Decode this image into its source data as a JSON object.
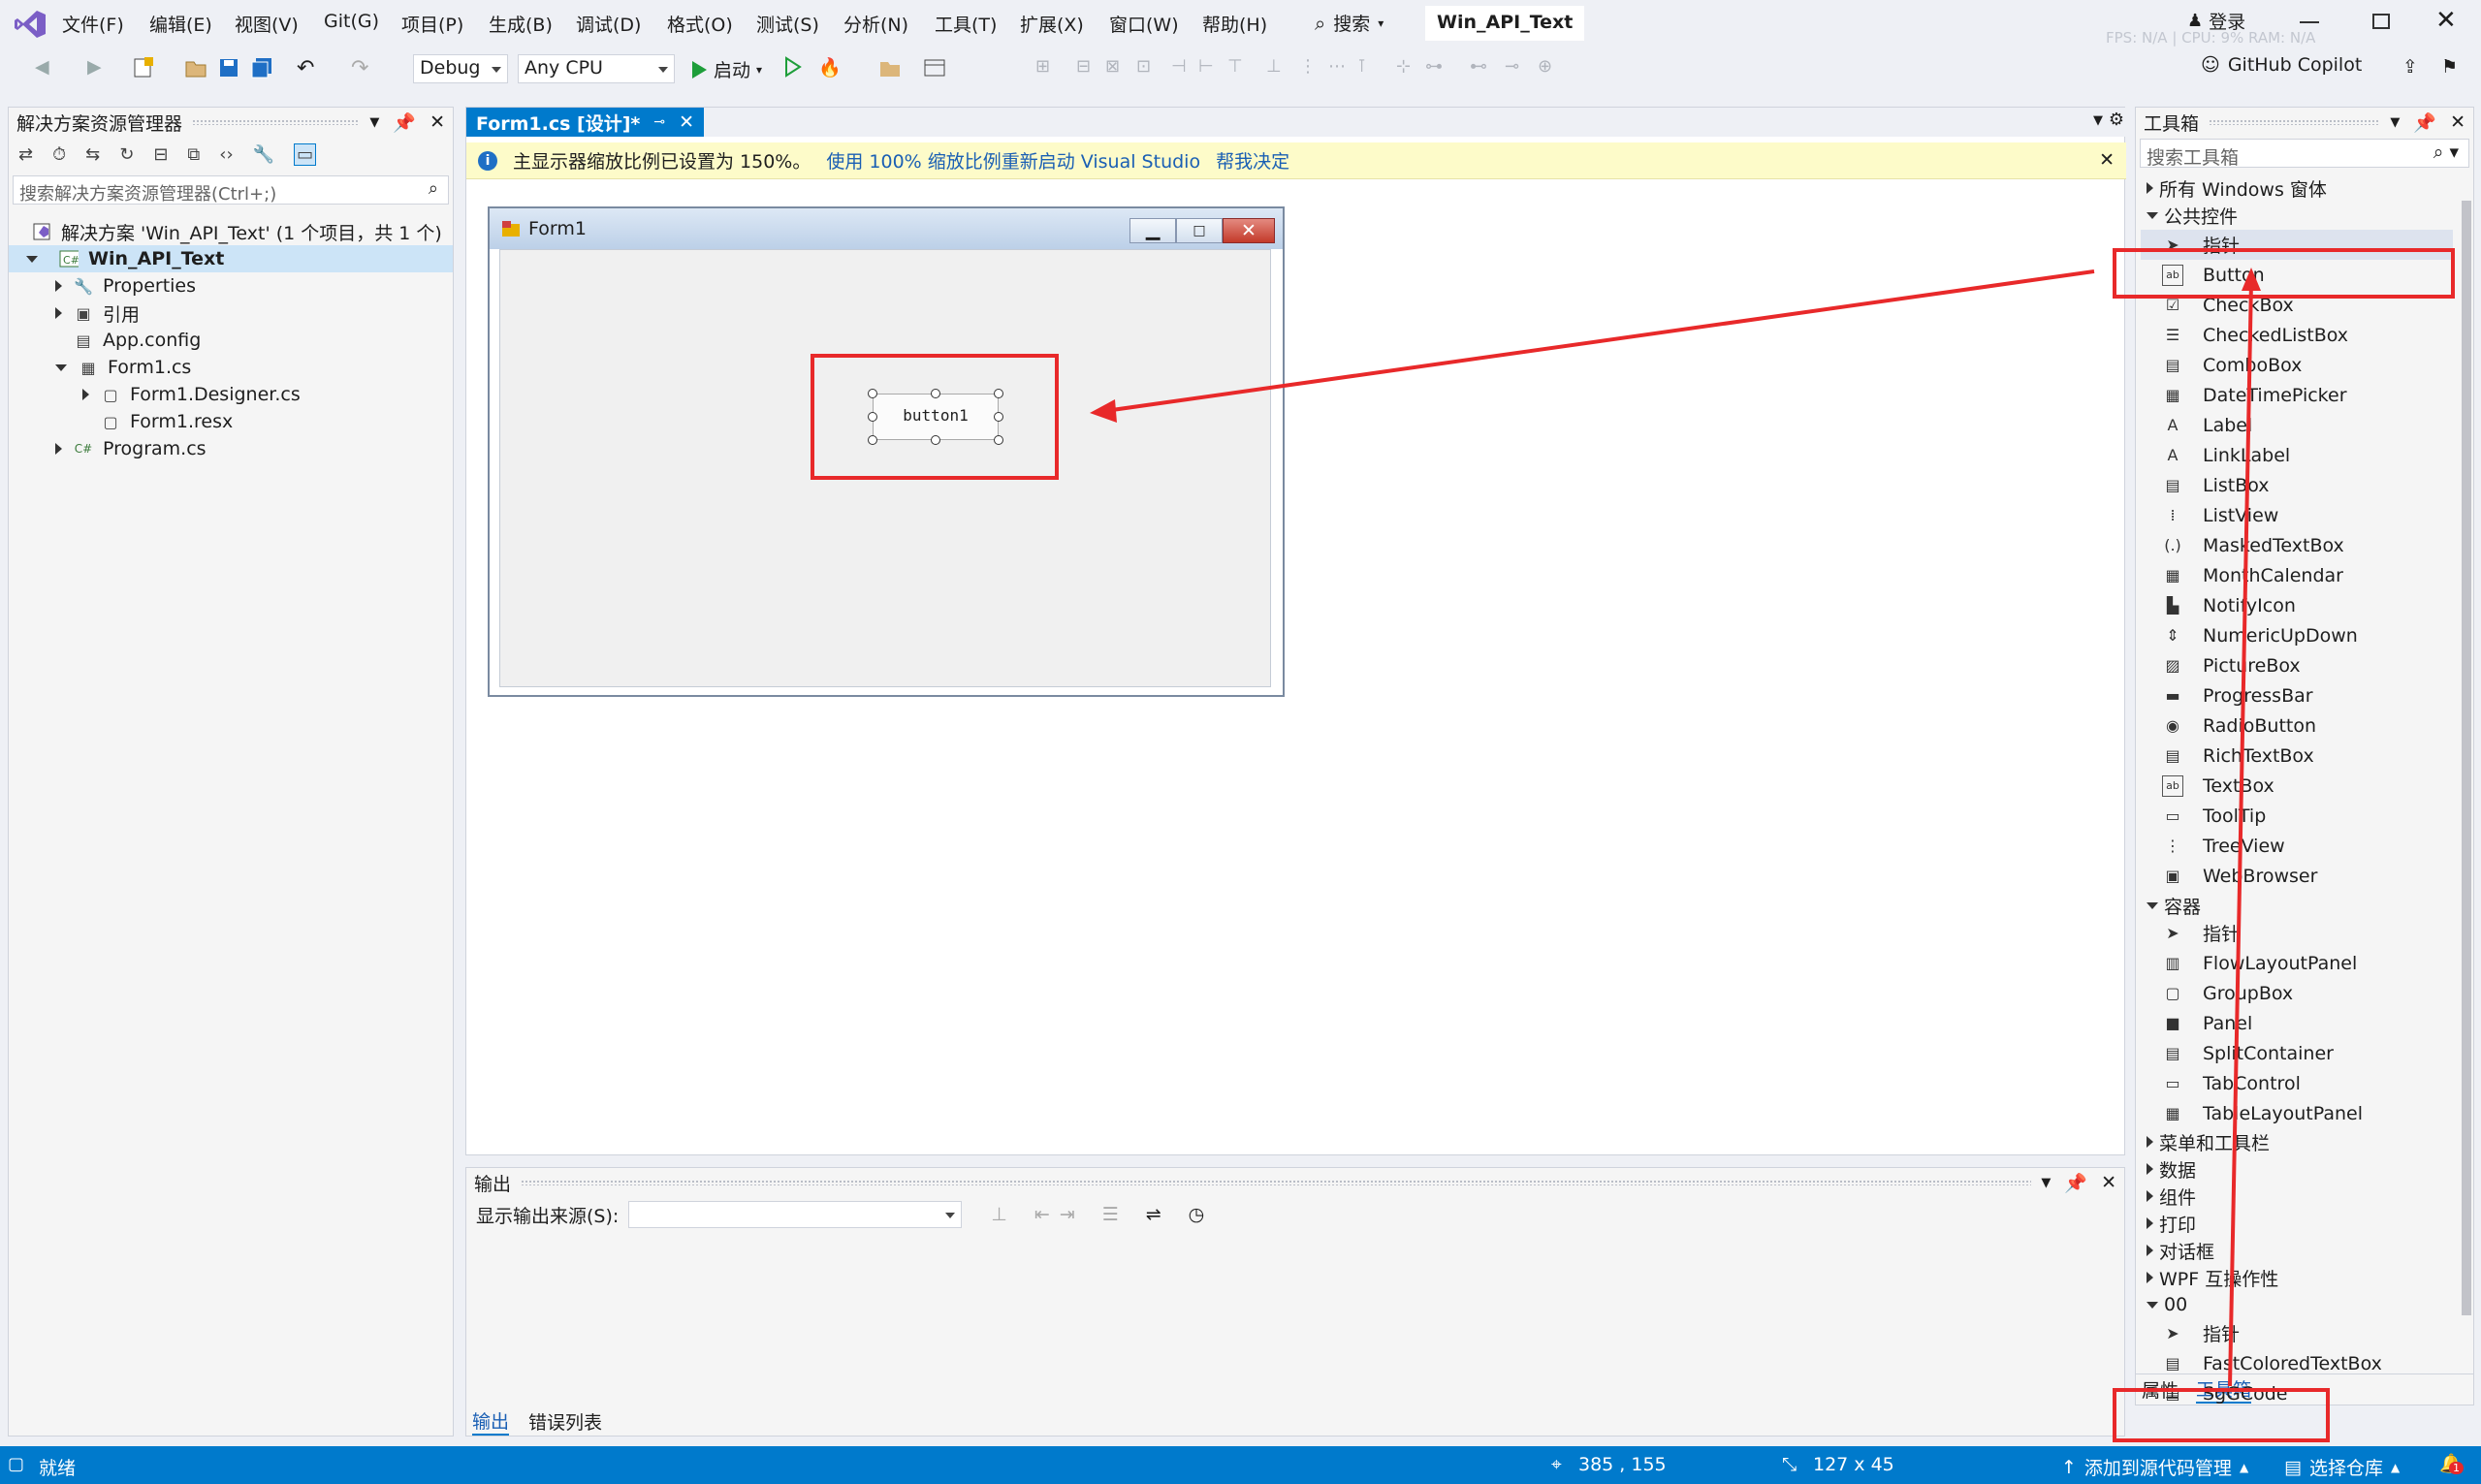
{
  "title_bar": {
    "menus": [
      "文件(F)",
      "编辑(E)",
      "视图(V)",
      "Git(G)",
      "项目(P)",
      "生成(B)",
      "调试(D)",
      "格式(O)",
      "测试(S)",
      "分析(N)",
      "工具(T)",
      "扩展(X)",
      "窗口(W)",
      "帮助(H)"
    ],
    "search_label": "搜索",
    "solution_name": "Win_API_Text",
    "login_label": "登录",
    "fps_overlay": "FPS: N/A  |  CPU: 9%  RAM: N/A",
    "github_copilot": "GitHub Copilot"
  },
  "toolbar": {
    "config": "Debug",
    "platform": "Any CPU",
    "start_label": "启动"
  },
  "solution_explorer": {
    "title": "解决方案资源管理器",
    "search_placeholder": "搜索解决方案资源管理器(Ctrl+;)",
    "solution_line": "解决方案 'Win_API_Text' (1 个项目，共 1 个)",
    "project": "Win_API_Text",
    "items": [
      "Properties",
      "引用",
      "App.config",
      "Form1.cs",
      "Form1.Designer.cs",
      "Form1.resx",
      "Program.cs"
    ]
  },
  "editor": {
    "tab_title": "Form1.cs [设计]*",
    "info_message": "主显示器缩放比例已设置为 150%。",
    "info_link1": "使用 100% 缩放比例重新启动 Visual Studio",
    "info_link2": "帮我决定",
    "form_title": "Form1",
    "button_text": "button1"
  },
  "output": {
    "title": "输出",
    "source_label": "显示输出来源(S):",
    "tabs": [
      "输出",
      "错误列表"
    ]
  },
  "toolbox": {
    "title": "工具箱",
    "search_placeholder": "搜索工具箱",
    "categories": {
      "all_windows": "所有 Windows 窗体",
      "common": "公共控件",
      "containers": "容器",
      "menus": "菜单和工具栏",
      "data": "数据",
      "components": "组件",
      "printing": "打印",
      "dialogs": "对话框",
      "wpf": "WPF 互操作性",
      "custom": "00"
    },
    "common_items": [
      "指针",
      "Button",
      "CheckBox",
      "CheckedListBox",
      "ComboBox",
      "DateTimePicker",
      "Label",
      "LinkLabel",
      "ListBox",
      "ListView",
      "MaskedTextBox",
      "MonthCalendar",
      "NotifyIcon",
      "NumericUpDown",
      "PictureBox",
      "ProgressBar",
      "RadioButton",
      "RichTextBox",
      "TextBox",
      "ToolTip",
      "TreeView",
      "WebBrowser"
    ],
    "container_items": [
      "指针",
      "FlowLayoutPanel",
      "GroupBox",
      "Panel",
      "SplitContainer",
      "TabControl",
      "TableLayoutPanel"
    ],
    "custom_items": [
      "指针",
      "FastColoredTextBox",
      "SgGCode"
    ],
    "bottom_tabs": [
      "属性",
      "工具箱"
    ]
  },
  "status_bar": {
    "ready": "就绪",
    "position": "385 , 155",
    "size": "127 x 45",
    "source_control": "添加到源代码管理",
    "repo": "选择仓库",
    "notifications": "1"
  },
  "colors": {
    "accent": "#007acc",
    "annotation": "#e8292a",
    "infobar": "#fdfbc9"
  }
}
